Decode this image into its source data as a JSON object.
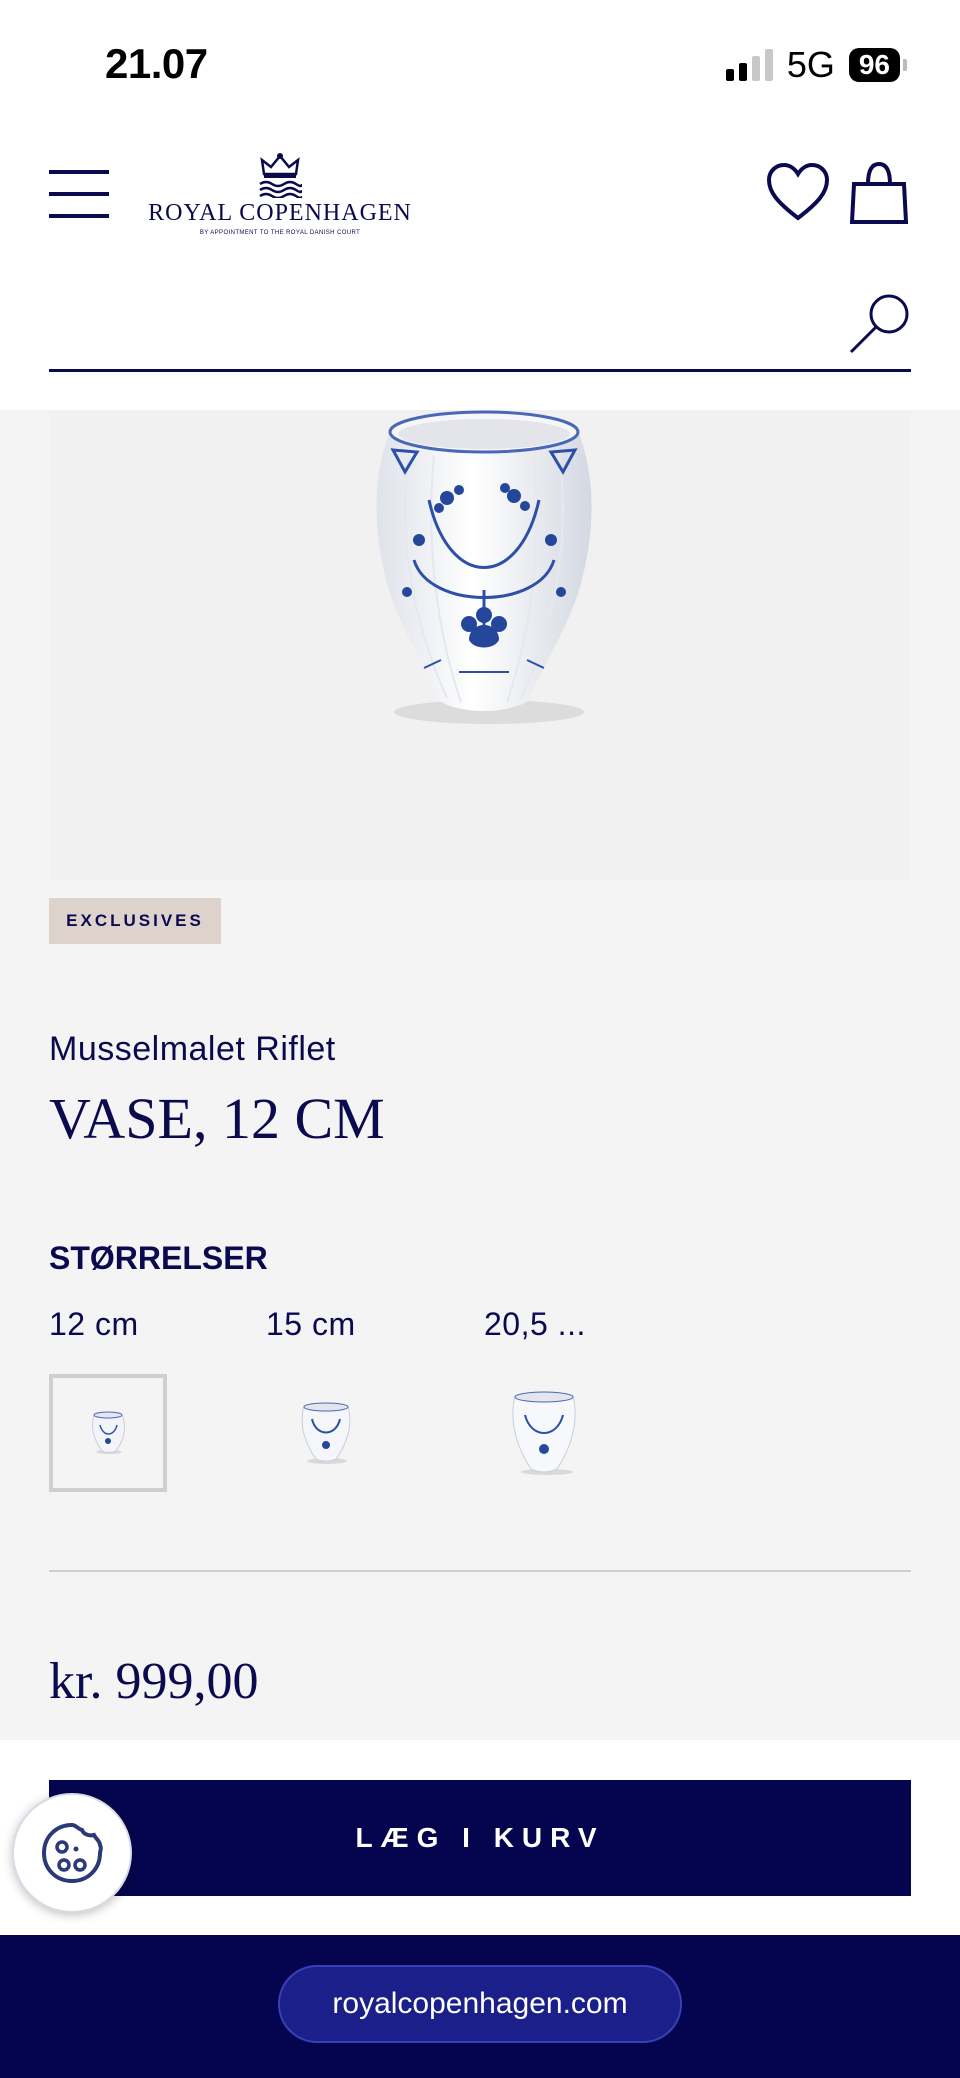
{
  "status_bar": {
    "time": "21.07",
    "network": "5G",
    "battery": "96"
  },
  "header": {
    "logo_name": "ROYAL COPENHAGEN",
    "logo_subtitle": "BY APPOINTMENT TO THE ROYAL DANISH COURT",
    "icons": [
      "hamburger-menu-icon",
      "heart-icon",
      "shopping-bag-icon",
      "search-icon"
    ]
  },
  "search": {
    "value": "",
    "placeholder": ""
  },
  "product": {
    "badge": "EXCLUSIVES",
    "collection": "Musselmalet Riflet",
    "title": "VASE, 12 CM",
    "sizes_heading": "STØRRELSER",
    "sizes": [
      {
        "label": "12 cm",
        "selected": true
      },
      {
        "label": "15 cm",
        "selected": false
      },
      {
        "label": "20,5 ...",
        "selected": false
      }
    ],
    "price": "kr. 999,00"
  },
  "cta": {
    "add_to_cart_label": "LÆG I KURV"
  },
  "browser": {
    "url": "royalcopenhagen.com"
  },
  "colors": {
    "brand_navy": "#05054f",
    "badge_bg": "#ddd3cc",
    "page_bg": "#f4f4f4"
  }
}
